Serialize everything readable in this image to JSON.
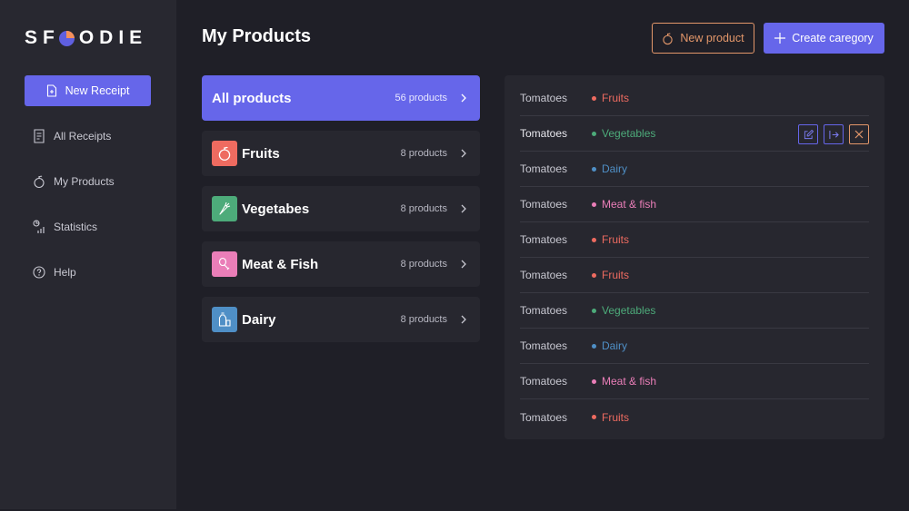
{
  "brand": {
    "logo_left": "SF",
    "logo_right": "ODIE"
  },
  "sidebar": {
    "new_receipt": "New Receipt",
    "items": [
      {
        "label": "All Receipts",
        "icon": "receipt-icon"
      },
      {
        "label": "My Products",
        "icon": "apple-icon"
      },
      {
        "label": "Statistics",
        "icon": "statistics-icon"
      },
      {
        "label": "Help",
        "icon": "help-icon"
      }
    ]
  },
  "header": {
    "title": "My Products",
    "new_product": "New product",
    "create_category": "Create caregory"
  },
  "categories": [
    {
      "name": "All products",
      "count": "56 products",
      "active": true
    },
    {
      "name": "Fruits",
      "count": "8 products",
      "color": "#ee6b60",
      "icon": "apple-icon"
    },
    {
      "name": "Vegetabes",
      "count": "8 products",
      "color": "#4dab7a",
      "icon": "carrot-icon"
    },
    {
      "name": "Meat & Fish",
      "count": "8 products",
      "color": "#ea7eb8",
      "icon": "drumstick-icon"
    },
    {
      "name": "Dairy",
      "count": "8 products",
      "color": "#4f8fc6",
      "icon": "milk-icon"
    }
  ],
  "tag_colors": {
    "Fruits": "#ee6b60",
    "Vegetables": "#4dab7a",
    "Dairy": "#4f8fc6",
    "Meat & fish": "#ea7eb8"
  },
  "products": [
    {
      "name": "Tomatoes",
      "tag": "Fruits"
    },
    {
      "name": "Tomatoes",
      "tag": "Vegetables",
      "hovered": true
    },
    {
      "name": "Tomatoes",
      "tag": "Dairy"
    },
    {
      "name": "Tomatoes",
      "tag": "Meat & fish"
    },
    {
      "name": "Tomatoes",
      "tag": "Fruits"
    },
    {
      "name": "Tomatoes",
      "tag": "Fruits"
    },
    {
      "name": "Tomatoes",
      "tag": "Vegetables"
    },
    {
      "name": "Tomatoes",
      "tag": "Dairy"
    },
    {
      "name": "Tomatoes",
      "tag": "Meat & fish"
    },
    {
      "name": "Tomatoes",
      "tag": "Fruits"
    }
  ],
  "colors": {
    "accent": "#6666ea",
    "warm": "#e3976a"
  }
}
